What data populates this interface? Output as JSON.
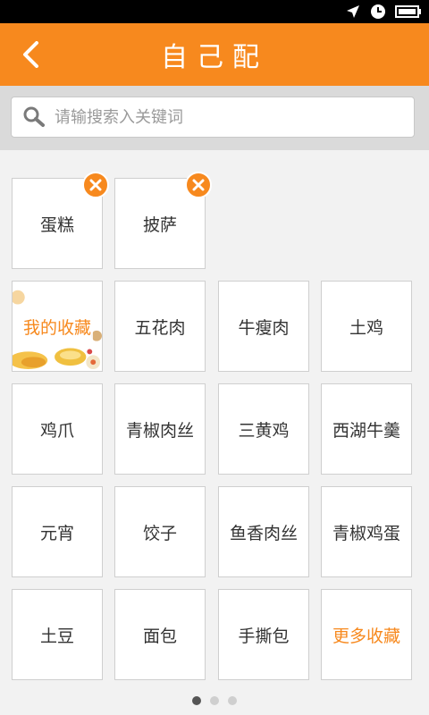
{
  "header": {
    "title": "自己配",
    "back_icon": "chevron-left-icon"
  },
  "search": {
    "placeholder": "请输搜索入关键词",
    "value": ""
  },
  "selected": [
    {
      "label": "蛋糕"
    },
    {
      "label": "披萨"
    }
  ],
  "grid": {
    "favorites_label": "我的收藏",
    "items": [
      "五花肉",
      "牛瘦肉",
      "土鸡",
      "鸡爪",
      "青椒肉丝",
      "三黄鸡",
      "西湖牛羹",
      "元宵",
      "饺子",
      "鱼香肉丝",
      "青椒鸡蛋",
      "土豆",
      "面包",
      "手撕包"
    ],
    "more_label": "更多收藏"
  },
  "pagination": {
    "pages": 3,
    "current": 1
  },
  "colors": {
    "accent": "#f7891e",
    "searchbar_bg": "#dadada",
    "page_bg": "#f2f2f2"
  }
}
